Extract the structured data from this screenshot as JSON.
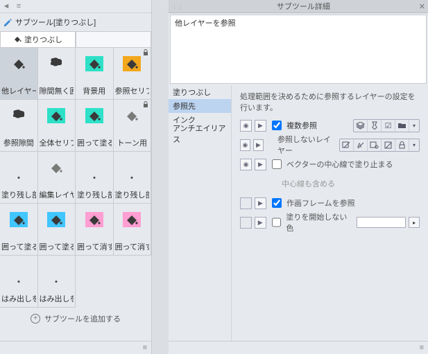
{
  "left": {
    "panel_title": "サブツール[塗りつぶし]",
    "active_tab": "塗りつぶし",
    "tools": [
      {
        "label": "他レイヤー",
        "shape": "bucket",
        "color": "#3a3a3a",
        "bg": "none",
        "locked": false,
        "selected": true
      },
      {
        "label": "隙間無く囲",
        "shape": "blob",
        "color": "#3a3a3a",
        "bg": "none",
        "locked": false
      },
      {
        "label": "背景用",
        "shape": "bucket",
        "color": "#3a3a3a",
        "bg": "#2de0c7",
        "locked": false
      },
      {
        "label": "参照セリフ",
        "shape": "bucket",
        "color": "#3a3a3a",
        "bg": "#f3a71c",
        "locked": true
      },
      {
        "label": "参照隙間",
        "shape": "blob",
        "color": "#3a3a3a",
        "bg": "none",
        "locked": false
      },
      {
        "label": "全体セリフ",
        "shape": "bucket",
        "color": "#3a3a3a",
        "bg": "#2de0c7",
        "locked": false
      },
      {
        "label": "囲って塗る",
        "shape": "bucket",
        "color": "#3a3a3a",
        "bg": "#2de0c7",
        "locked": false
      },
      {
        "label": "トーン用",
        "shape": "bucket",
        "color": "#7a7a7a",
        "bg": "none",
        "locked": true
      },
      {
        "label": "塗り残し部",
        "shape": "dot",
        "color": "#444",
        "bg": "none",
        "locked": false
      },
      {
        "label": "編集レイヤ",
        "shape": "bucket",
        "color": "#7a7a7a",
        "bg": "none",
        "locked": false
      },
      {
        "label": "塗り残し部",
        "shape": "dot",
        "color": "#444",
        "bg": "none",
        "locked": false
      },
      {
        "label": "塗り残し部",
        "shape": "dot",
        "color": "#444",
        "bg": "none",
        "locked": false
      },
      {
        "label": "囲って塗る",
        "shape": "bucket",
        "color": "#3a3a3a",
        "bg": "#41c6ff",
        "locked": false
      },
      {
        "label": "囲って塗る",
        "shape": "bucket",
        "color": "#3a3a3a",
        "bg": "#41c6ff",
        "locked": false
      },
      {
        "label": "囲って消す",
        "shape": "bucket",
        "color": "#3a3a3a",
        "bg": "#ff9ed2",
        "locked": false
      },
      {
        "label": "囲って消す",
        "shape": "bucket",
        "color": "#3a3a3a",
        "bg": "#ff9ed2",
        "locked": false
      },
      {
        "label": "はみ出しを",
        "shape": "dot",
        "color": "#444",
        "bg": "none",
        "locked": false
      },
      {
        "label": "はみ出しを",
        "shape": "dot",
        "color": "#444",
        "bg": "none",
        "locked": false
      }
    ],
    "add_label": "サブツールを追加する"
  },
  "right": {
    "title": "サブツール詳細",
    "preview_label": "他レイヤーを参照",
    "categories": [
      "塗りつぶし",
      "参照先",
      "インク",
      "アンチエイリアス"
    ],
    "selected_category": 1,
    "description": "処理範囲を決めるために参照するレイヤーの設定を行います。",
    "row_multi_ref": {
      "label": "複数参照",
      "checked": true
    },
    "row_exclude": {
      "label": "参照しないレイヤー"
    },
    "row_vector_center": {
      "label": "ベクターの中心線で塗り止まる",
      "checked": false
    },
    "row_include_center": {
      "label": "中心線も含める"
    },
    "row_frame": {
      "label": "作画フレームを参照",
      "checked": true
    },
    "row_no_start_color": {
      "label": "塗りを開始しない色",
      "checked": false
    }
  }
}
